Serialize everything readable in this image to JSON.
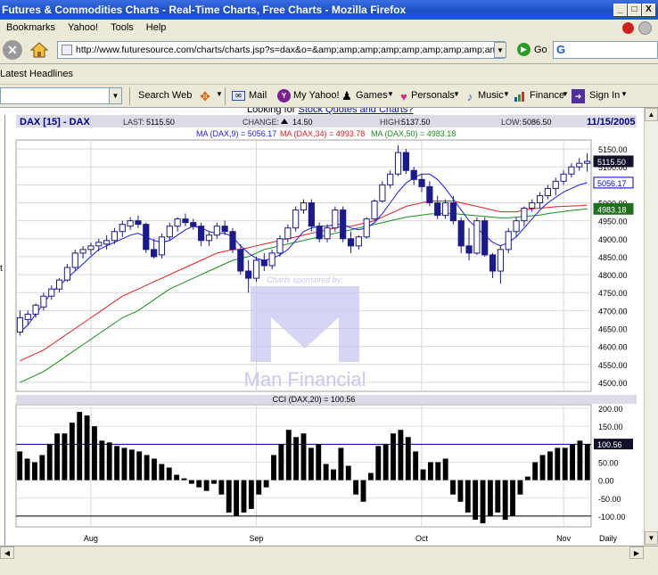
{
  "window": {
    "title": "Futures & Commodities Charts - Real-Time Charts, Free Charts - Mozilla Firefox",
    "minimize_glyph": "_",
    "maximize_glyph": "□",
    "close_glyph": "X"
  },
  "menu": {
    "items": [
      {
        "label": "Bookmarks"
      },
      {
        "label": "Yahoo!"
      },
      {
        "label": "Tools"
      },
      {
        "label": "Help"
      }
    ]
  },
  "nav": {
    "url": "http://www.futuresource.com/charts/charts.jsp?s=dax&o=&amp;amp;amp;amp;amp;amp;amp;amp;amp;a=D",
    "go_label": "Go",
    "search_logo": "G"
  },
  "headlines": {
    "label": "Latest Headlines"
  },
  "yahoo_toolbar": {
    "search_web": "Search Web",
    "mail": "Mail",
    "my_yahoo": "My Yahoo!",
    "games": "Games",
    "personals": "Personals",
    "music": "Music",
    "finance": "Finance",
    "sign_in": "Sign In"
  },
  "page": {
    "top_link_prefix": "Looking for ",
    "top_link": "Stock Quotes and Charts?"
  },
  "colors": {
    "ma9": "#1a1aee",
    "ma34": "#e02020",
    "ma50": "#189018",
    "candle": "#1a1a8c",
    "header_bg": "#dcdce8",
    "watermark": "#c8c8f0"
  },
  "chart_data": [
    {
      "type": "candlestick",
      "header": {
        "symbol": "DAX [15] - DAX",
        "last_label": "LAST:",
        "last": "5115.50",
        "change_label": "CHANGE:",
        "change": "14.50",
        "high_label": "HIGH:",
        "high": "5137.50",
        "low_label": "LOW:",
        "low": "5086.50",
        "date": "11/15/2005"
      },
      "ma_labels": [
        {
          "label": "MA (DAX,9) = 5056.17",
          "color": "#1a1aee"
        },
        {
          "label": "MA (DAX,34) = 4993.78",
          "color": "#e02020"
        },
        {
          "label": "MA (DAX,50) = 4983.18",
          "color": "#189018"
        }
      ],
      "y_ticks": [
        4500,
        4550,
        4600,
        4650,
        4700,
        4750,
        4800,
        4850,
        4900,
        4950,
        5000,
        5050,
        5100,
        5150
      ],
      "ylim": [
        4475,
        5175
      ],
      "right_tags": [
        {
          "value": 5115.5,
          "label": "5115.50",
          "style": "dark"
        },
        {
          "value": 5056.17,
          "label": "5056.17",
          "style": "blue"
        },
        {
          "value": 4983.18,
          "label": "4983.18",
          "style": "green"
        }
      ],
      "bars": [
        {
          "o": 4640,
          "h": 4700,
          "l": 4630,
          "c": 4680
        },
        {
          "o": 4675,
          "h": 4700,
          "l": 4660,
          "c": 4690
        },
        {
          "o": 4690,
          "h": 4720,
          "l": 4680,
          "c": 4715
        },
        {
          "o": 4710,
          "h": 4750,
          "l": 4700,
          "c": 4740
        },
        {
          "o": 4740,
          "h": 4770,
          "l": 4730,
          "c": 4760
        },
        {
          "o": 4760,
          "h": 4790,
          "l": 4750,
          "c": 4785
        },
        {
          "o": 4785,
          "h": 4830,
          "l": 4780,
          "c": 4820
        },
        {
          "o": 4820,
          "h": 4870,
          "l": 4810,
          "c": 4860
        },
        {
          "o": 4860,
          "h": 4880,
          "l": 4845,
          "c": 4870
        },
        {
          "o": 4870,
          "h": 4890,
          "l": 4855,
          "c": 4880
        },
        {
          "o": 4880,
          "h": 4900,
          "l": 4865,
          "c": 4890
        },
        {
          "o": 4885,
          "h": 4910,
          "l": 4870,
          "c": 4895
        },
        {
          "o": 4895,
          "h": 4930,
          "l": 4885,
          "c": 4920
        },
        {
          "o": 4920,
          "h": 4950,
          "l": 4905,
          "c": 4940
        },
        {
          "o": 4935,
          "h": 4960,
          "l": 4925,
          "c": 4950
        },
        {
          "o": 4950,
          "h": 4965,
          "l": 4930,
          "c": 4940
        },
        {
          "o": 4940,
          "h": 4945,
          "l": 4860,
          "c": 4870
        },
        {
          "o": 4870,
          "h": 4900,
          "l": 4845,
          "c": 4850
        },
        {
          "o": 4855,
          "h": 4915,
          "l": 4845,
          "c": 4905
        },
        {
          "o": 4905,
          "h": 4945,
          "l": 4895,
          "c": 4935
        },
        {
          "o": 4935,
          "h": 4960,
          "l": 4920,
          "c": 4955
        },
        {
          "o": 4955,
          "h": 4970,
          "l": 4935,
          "c": 4945
        },
        {
          "o": 4945,
          "h": 4955,
          "l": 4925,
          "c": 4935
        },
        {
          "o": 4935,
          "h": 4945,
          "l": 4880,
          "c": 4895
        },
        {
          "o": 4895,
          "h": 4920,
          "l": 4880,
          "c": 4910
        },
        {
          "o": 4910,
          "h": 4945,
          "l": 4900,
          "c": 4935
        },
        {
          "o": 4935,
          "h": 4950,
          "l": 4910,
          "c": 4920
        },
        {
          "o": 4920,
          "h": 4930,
          "l": 4860,
          "c": 4870
        },
        {
          "o": 4870,
          "h": 4885,
          "l": 4800,
          "c": 4810
        },
        {
          "o": 4810,
          "h": 4840,
          "l": 4750,
          "c": 4790
        },
        {
          "o": 4790,
          "h": 4850,
          "l": 4780,
          "c": 4840
        },
        {
          "o": 4840,
          "h": 4860,
          "l": 4810,
          "c": 4825
        },
        {
          "o": 4825,
          "h": 4870,
          "l": 4815,
          "c": 4860
        },
        {
          "o": 4860,
          "h": 4910,
          "l": 4850,
          "c": 4900
        },
        {
          "o": 4900,
          "h": 4940,
          "l": 4890,
          "c": 4930
        },
        {
          "o": 4930,
          "h": 4990,
          "l": 4920,
          "c": 4980
        },
        {
          "o": 4980,
          "h": 5010,
          "l": 4970,
          "c": 5000
        },
        {
          "o": 5000,
          "h": 5010,
          "l": 4920,
          "c": 4935
        },
        {
          "o": 4935,
          "h": 4945,
          "l": 4890,
          "c": 4900
        },
        {
          "o": 4900,
          "h": 4940,
          "l": 4890,
          "c": 4930
        },
        {
          "o": 4930,
          "h": 4990,
          "l": 4920,
          "c": 4980
        },
        {
          "o": 4980,
          "h": 4990,
          "l": 4890,
          "c": 4900
        },
        {
          "o": 4900,
          "h": 4920,
          "l": 4860,
          "c": 4880
        },
        {
          "o": 4880,
          "h": 4910,
          "l": 4870,
          "c": 4905
        },
        {
          "o": 4905,
          "h": 4960,
          "l": 4900,
          "c": 4955
        },
        {
          "o": 4955,
          "h": 5010,
          "l": 4950,
          "c": 5005
        },
        {
          "o": 5005,
          "h": 5060,
          "l": 5000,
          "c": 5050
        },
        {
          "o": 5050,
          "h": 5090,
          "l": 5040,
          "c": 5080
        },
        {
          "o": 5080,
          "h": 5160,
          "l": 5075,
          "c": 5140
        },
        {
          "o": 5140,
          "h": 5150,
          "l": 5080,
          "c": 5090
        },
        {
          "o": 5090,
          "h": 5100,
          "l": 5050,
          "c": 5065
        },
        {
          "o": 5065,
          "h": 5080,
          "l": 5030,
          "c": 5045
        },
        {
          "o": 5045,
          "h": 5060,
          "l": 4990,
          "c": 5000
        },
        {
          "o": 5000,
          "h": 5020,
          "l": 4955,
          "c": 4965
        },
        {
          "o": 4965,
          "h": 5010,
          "l": 4955,
          "c": 5000
        },
        {
          "o": 5000,
          "h": 5020,
          "l": 4940,
          "c": 4950
        },
        {
          "o": 4950,
          "h": 4960,
          "l": 4860,
          "c": 4880
        },
        {
          "o": 4880,
          "h": 4930,
          "l": 4840,
          "c": 4860
        },
        {
          "o": 4860,
          "h": 4960,
          "l": 4855,
          "c": 4950
        },
        {
          "o": 4950,
          "h": 4960,
          "l": 4850,
          "c": 4855
        },
        {
          "o": 4855,
          "h": 4860,
          "l": 4790,
          "c": 4810
        },
        {
          "o": 4810,
          "h": 4880,
          "l": 4775,
          "c": 4870
        },
        {
          "o": 4870,
          "h": 4930,
          "l": 4860,
          "c": 4920
        },
        {
          "o": 4920,
          "h": 4960,
          "l": 4905,
          "c": 4950
        },
        {
          "o": 4950,
          "h": 4990,
          "l": 4935,
          "c": 4985
        },
        {
          "o": 4985,
          "h": 5010,
          "l": 4975,
          "c": 5000
        },
        {
          "o": 5000,
          "h": 5030,
          "l": 4985,
          "c": 5020
        },
        {
          "o": 5020,
          "h": 5050,
          "l": 5010,
          "c": 5040
        },
        {
          "o": 5040,
          "h": 5070,
          "l": 5020,
          "c": 5060
        },
        {
          "o": 5060,
          "h": 5090,
          "l": 5050,
          "c": 5080
        },
        {
          "o": 5080,
          "h": 5110,
          "l": 5070,
          "c": 5100
        },
        {
          "o": 5100,
          "h": 5125,
          "l": 5090,
          "c": 5110
        },
        {
          "o": 5110,
          "h": 5137.5,
          "l": 5086.5,
          "c": 5115.5
        }
      ],
      "ma9": [
        4640,
        4660,
        4690,
        4720,
        4750,
        4770,
        4790,
        4810,
        4830,
        4850,
        4870,
        4880,
        4890,
        4900,
        4910,
        4915,
        4905,
        4895,
        4890,
        4895,
        4910,
        4925,
        4935,
        4930,
        4920,
        4915,
        4915,
        4905,
        4880,
        4860,
        4845,
        4840,
        4845,
        4855,
        4870,
        4895,
        4920,
        4930,
        4935,
        4935,
        4940,
        4940,
        4930,
        4925,
        4930,
        4945,
        4970,
        5000,
        5030,
        5055,
        5070,
        5080,
        5080,
        5065,
        5040,
        5010,
        4980,
        4950,
        4930,
        4910,
        4890,
        4880,
        4890,
        4905,
        4930,
        4955,
        4980,
        5000,
        5015,
        5030,
        5040,
        5050,
        5056.17
      ],
      "ma34": [
        4560,
        4570,
        4580,
        4590,
        4605,
        4620,
        4635,
        4650,
        4665,
        4680,
        4695,
        4710,
        4725,
        4740,
        4750,
        4760,
        4770,
        4780,
        4790,
        4800,
        4810,
        4820,
        4830,
        4840,
        4850,
        4860,
        4865,
        4870,
        4870,
        4875,
        4880,
        4885,
        4890,
        4895,
        4900,
        4905,
        4910,
        4915,
        4920,
        4925,
        4930,
        4935,
        4935,
        4940,
        4945,
        4950,
        4960,
        4970,
        4980,
        4990,
        4995,
        5000,
        5005,
        5005,
        5005,
        5005,
        5000,
        4995,
        4990,
        4985,
        4980,
        4975,
        4975,
        4975,
        4980,
        4983,
        4985,
        4987,
        4989,
        4990,
        4991,
        4992,
        4993.78
      ],
      "ma50": [
        4500,
        4510,
        4520,
        4530,
        4545,
        4560,
        4575,
        4590,
        4605,
        4620,
        4635,
        4650,
        4665,
        4680,
        4690,
        4700,
        4715,
        4730,
        4745,
        4760,
        4770,
        4780,
        4790,
        4800,
        4810,
        4820,
        4830,
        4840,
        4845,
        4850,
        4860,
        4870,
        4875,
        4880,
        4885,
        4890,
        4895,
        4900,
        4905,
        4910,
        4915,
        4920,
        4925,
        4930,
        4935,
        4940,
        4945,
        4950,
        4955,
        4960,
        4963,
        4966,
        4969,
        4970,
        4970,
        4970,
        4968,
        4966,
        4964,
        4962,
        4960,
        4958,
        4958,
        4960,
        4962,
        4964,
        4966,
        4970,
        4973,
        4976,
        4979,
        4981,
        4983.18
      ],
      "x_ticks": [
        {
          "label": "Aug",
          "bar": 9
        },
        {
          "label": "Sep",
          "bar": 30
        },
        {
          "label": "Oct",
          "bar": 51
        },
        {
          "label": "Nov",
          "bar": 69
        }
      ],
      "x_label_right": "Daily",
      "sponsor": {
        "line1": "Charts sponsored by:",
        "brand": "Man Financial"
      }
    },
    {
      "type": "bar",
      "title": "CCI (DAX,20) = 100.56",
      "y_ticks": [
        -100,
        -50,
        0,
        50,
        100,
        150,
        200
      ],
      "y_tick_labels": [
        "-100.00",
        "-50.00",
        "0.00",
        "50.00",
        "100.00",
        "150.00",
        "200.00"
      ],
      "ylim": [
        -130,
        210
      ],
      "reference_lines": [
        100,
        -100
      ],
      "current_tag": "100.56",
      "values": [
        80,
        60,
        50,
        70,
        100,
        130,
        130,
        160,
        190,
        180,
        150,
        110,
        105,
        95,
        90,
        85,
        80,
        70,
        60,
        45,
        35,
        15,
        5,
        -10,
        -20,
        -30,
        -10,
        -40,
        -90,
        -100,
        -90,
        -80,
        -40,
        -20,
        70,
        100,
        140,
        120,
        130,
        90,
        100,
        45,
        30,
        90,
        40,
        -40,
        -60,
        20,
        95,
        100,
        130,
        140,
        120,
        80,
        30,
        50,
        50,
        60,
        -40,
        -60,
        -90,
        -110,
        -120,
        -100,
        -90,
        -110,
        -100,
        -40,
        10,
        50,
        70,
        80,
        90,
        90,
        100,
        110,
        100.56
      ]
    }
  ]
}
